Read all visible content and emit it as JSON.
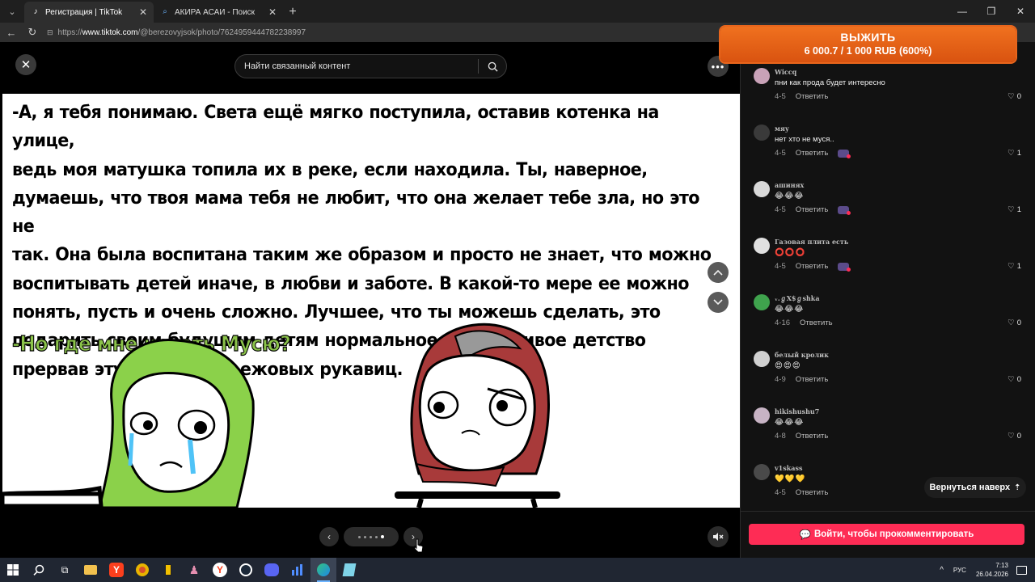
{
  "browser": {
    "tabs": [
      {
        "title": "Регистрация | TikTok",
        "favicon": "tiktok-icon",
        "active": true
      },
      {
        "title": "АКИРА АСАИ - Поиск",
        "favicon": "search-icon",
        "active": false
      }
    ],
    "url": {
      "prefix": "https://",
      "host": "www.tiktok.com",
      "path": "/@berezovyjsok/photo/7624959444782238997"
    }
  },
  "promo": {
    "title": "ВЫЖИТЬ",
    "amount": "6 000.7 / 1 000 RUB (600%)",
    "color": "#e8651c"
  },
  "viewer": {
    "search_placeholder": "Найти связанный контент",
    "comic_text": "-А, я тебя понимаю. Света ещё мягко поступила, оставив котенка на улице, ведь моя матушка топила их в реке, если находила. Ты, наверное, думаешь, что твоя мама тебя не любит, что она желает тебе зла, но это не так. Она была воспитана таким же образом и просто не знает, что можно воспитывать детей иначе, в любви и заботе. В какой-то мере ее можно понять, пусть и очень сложно. Лучшее, что ты можешь сделать, это подарить своим будущим детям нормальное и счастливое детство прервав эту цепочку из ежовых рукавиц.",
    "comic_text_lines": [
      "-А, я тебя понимаю. Света ещё мягко поступила, оставив котенка на улице,",
      "ведь моя матушка топила их в реке, если находила. Ты, наверное,",
      "думаешь, что твоя мама тебя не любит, что она желает тебе зла, но это не",
      "так. Она была воспитана таким же образом и просто не знает, что можно",
      "воспитывать детей иначе, в любви и заботе. В какой-то мере ее можно",
      "понять, пусть и очень сложно. Лучшее, что ты можешь сделать, это",
      "подарить своим будущим детям нормальное и счастливое детство",
      "прервав эту цепочку из ежовых рукавиц."
    ],
    "comic_question": "-Но где мне искать Мусю?",
    "pager": {
      "total": 5,
      "current": 5
    }
  },
  "comments": [
    {
      "name": "Wiccq",
      "text": "пни как прода будет интересно",
      "date": "4-5",
      "reply": "Ответить",
      "likes": "0",
      "creator_reacted": false,
      "avatar_color": "#c9a2b8"
    },
    {
      "name": "мяу",
      "text": "нет хто не муся..",
      "date": "4-5",
      "reply": "Ответить",
      "likes": "1",
      "creator_reacted": true,
      "avatar_color": "#3a3a3a"
    },
    {
      "name": "ашинях",
      "text": "😂😂😂",
      "date": "4-5",
      "reply": "Ответить",
      "likes": "1",
      "creator_reacted": true,
      "avatar_color": "#d9d9d9"
    },
    {
      "name": "Газовая плита есть",
      "text": "⭕⭕⭕",
      "date": "4-5",
      "reply": "Ответить",
      "likes": "1",
      "creator_reacted": true,
      "avatar_color": "#e0e0e0"
    },
    {
      "name": "ᵥ.ℊX$ℊshka",
      "text": "😂😂😂",
      "date": "4-16",
      "reply": "Ответить",
      "likes": "0",
      "creator_reacted": false,
      "avatar_color": "#3fa34d"
    },
    {
      "name": "белый кролик",
      "text": "😍😍😍",
      "date": "4-9",
      "reply": "Ответить",
      "likes": "0",
      "creator_reacted": false,
      "avatar_color": "#d0d0d0"
    },
    {
      "name": "hikishushu7",
      "text": "😂😂😂",
      "date": "4-8",
      "reply": "Ответить",
      "likes": "0",
      "creator_reacted": false,
      "avatar_color": "#c7b3c4"
    },
    {
      "name": "v1skass",
      "text": "💛💛💛",
      "date": "4-5",
      "reply": "Ответить",
      "likes": "",
      "creator_reacted": false,
      "avatar_color": "#4a4a4a"
    }
  ],
  "panel": {
    "back_to_top": "Вернуться наверх",
    "login_to_comment": "Войти, чтобы прокомментировать",
    "accent": "#fe2c55"
  },
  "taskbar": {
    "apps": [
      "windows-start-icon",
      "search-icon",
      "task-view-icon",
      "file-explorer-icon",
      "yandex-icon",
      "chrome-icon",
      "beer-app-icon",
      "game-icon",
      "yandex-browser-icon",
      "steam-icon",
      "discord-icon",
      "chart-app-icon",
      "edge-icon",
      "notepad-icon"
    ],
    "lang": "РУС",
    "time": "7:13",
    "date": "26.04.2026"
  }
}
